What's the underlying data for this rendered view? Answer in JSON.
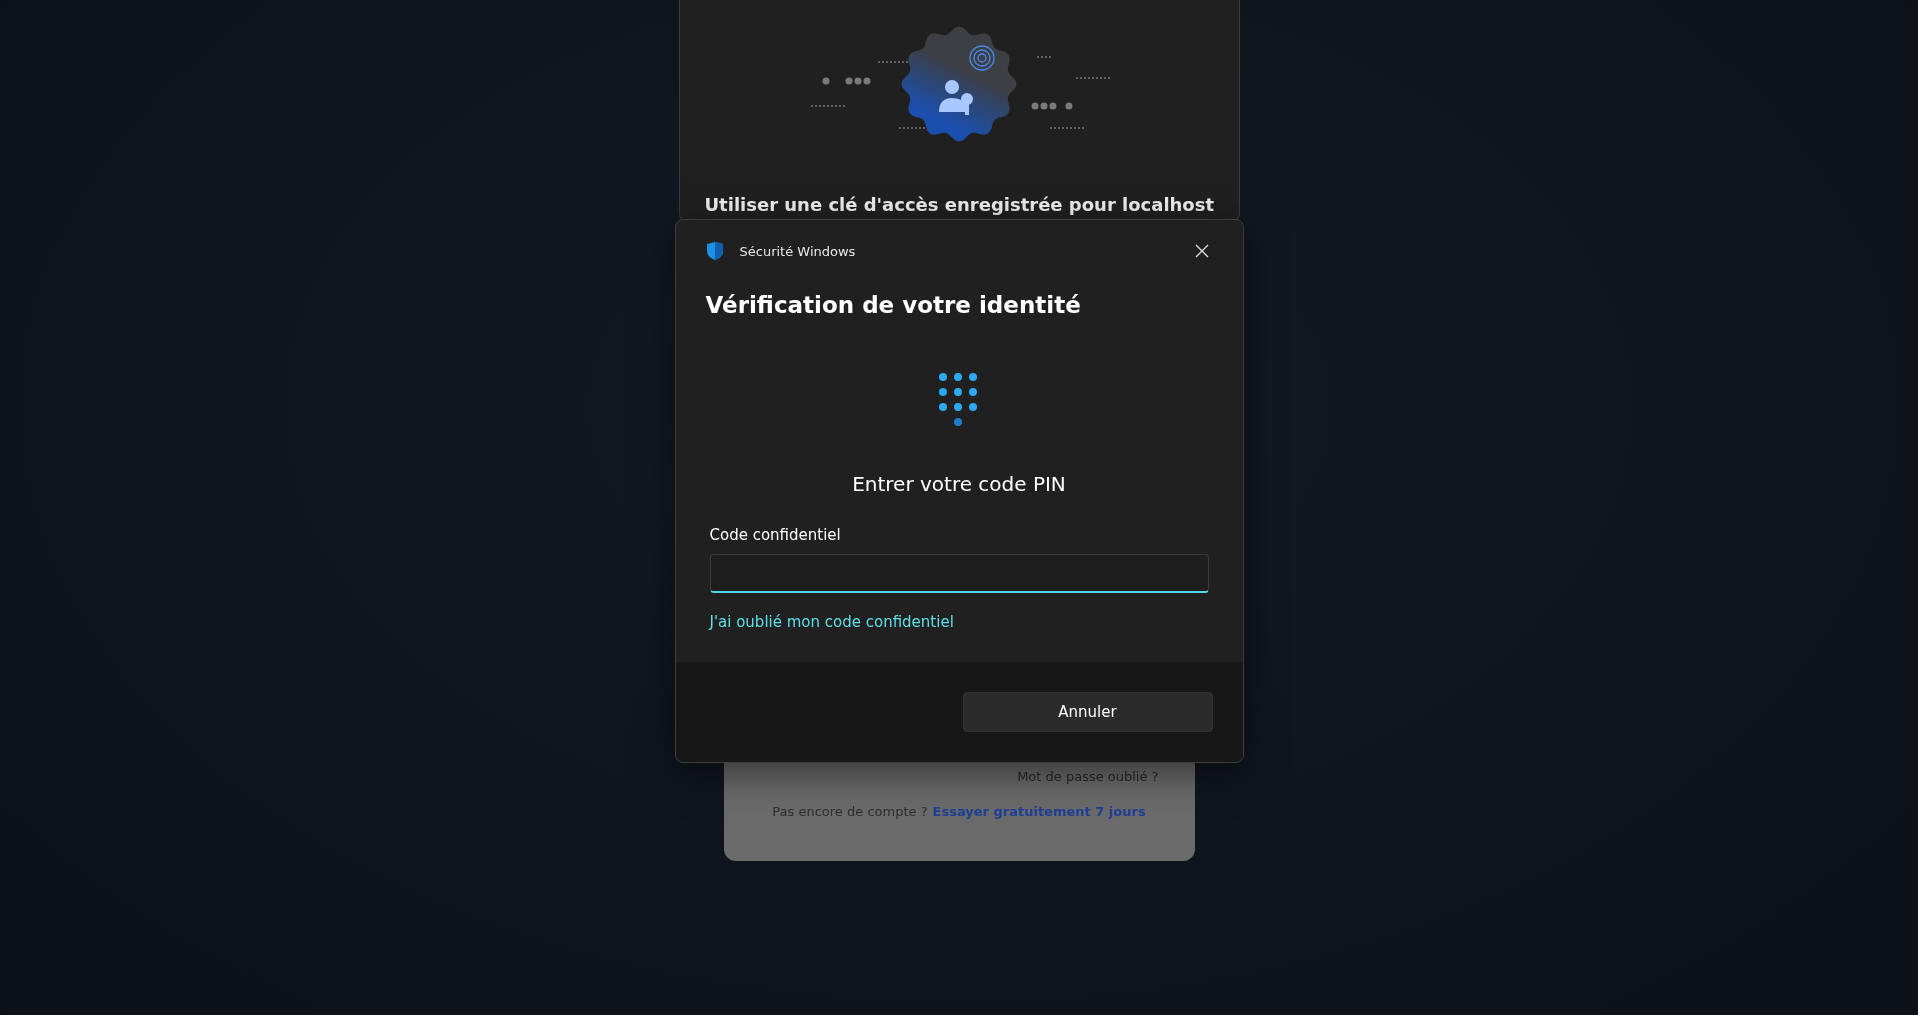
{
  "passkey_panel": {
    "title": "Utiliser une clé d'accès enregistrée pour localhost"
  },
  "dialog": {
    "app_name": "Sécurité Windows",
    "heading": "Vérification de votre identité",
    "prompt": "Entrer votre code PIN",
    "pin_field": {
      "label": "Code confidentiel",
      "focused": true
    },
    "forgot_link": "J'ai oublié mon code confidentiel",
    "buttons": [
      {
        "label": "Annuler"
      }
    ]
  },
  "login_card": {
    "forgot_password": "Mot de passe oublié ?",
    "signup_prompt": "Pas encore de compte ?",
    "signup_link": "Essayer gratuitement 7 jours"
  }
}
